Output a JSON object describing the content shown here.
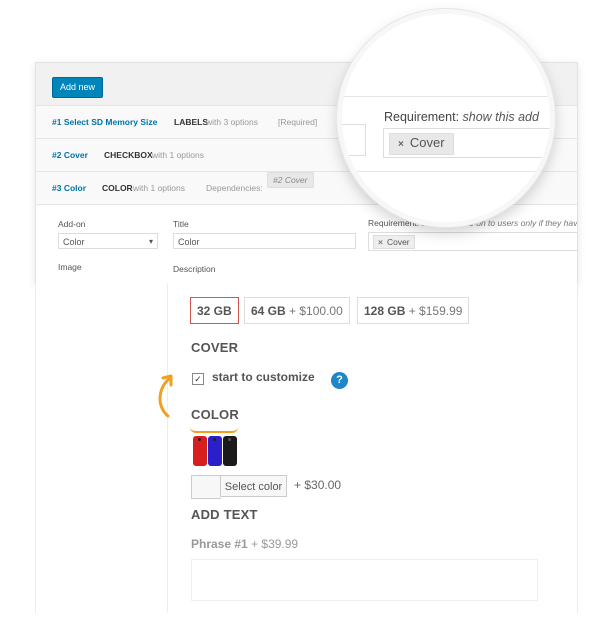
{
  "admin": {
    "add_new_label": "Add new",
    "rows": [
      {
        "title": "#1 Select SD Memory Size",
        "type": "LABELS",
        "meta": "with 3 options",
        "extra": "[Required]"
      },
      {
        "title": "#2 Cover",
        "type": "CHECKBOX",
        "meta": "with 1 options"
      },
      {
        "title": "#3 Color",
        "type": "COLOR",
        "meta": "with 1 options",
        "dependencies_label": "Dependencies:",
        "dependency": "#2 Cover"
      }
    ],
    "form": {
      "addon_label": "Add-on",
      "addon_value": "Color",
      "title_label": "Title",
      "title_value": "Color",
      "requirement_label": "Requirement:",
      "requirement_hint": "show this add-on to users only if they hav",
      "requirement_tag": "Cover",
      "image_label": "Image",
      "description_label": "Description"
    },
    "magnifier": {
      "label": "Requirement:",
      "hint": "show this add",
      "tag": "Cover"
    }
  },
  "front": {
    "sizes": [
      {
        "label": "32 GB",
        "price": "",
        "selected": true
      },
      {
        "label": "64 GB",
        "price": "+ $100.00",
        "selected": false
      },
      {
        "label": "128 GB",
        "price": "+ $159.99",
        "selected": false
      }
    ],
    "cover_heading": "COVER",
    "cover_checkbox_label": "start to customize",
    "cover_checked": true,
    "help_icon": "?",
    "color_heading": "COLOR",
    "select_color_label": "Select color",
    "color_price": "+ $30.00",
    "add_text_heading": "ADD TEXT",
    "phrase_label": "Phrase #1",
    "phrase_price": "+ $39.99"
  },
  "colors": {
    "accent_blue": "#0085ba",
    "selected_border": "#d9534f",
    "highlight_orange": "#f0a020",
    "phone_colors": [
      "#d91e1e",
      "#2a1fc9",
      "#1a1a1a"
    ]
  }
}
